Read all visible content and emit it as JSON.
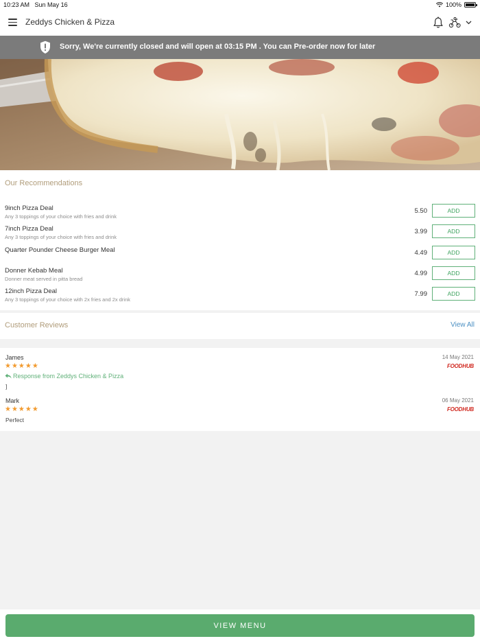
{
  "status_bar": {
    "time": "10:23 AM",
    "date": "Sun May 16",
    "battery": "100%",
    "battery_level": 1.0
  },
  "app_bar": {
    "title": "Zeddys Chicken & Pizza",
    "icons": [
      "menu-icon",
      "bell-icon",
      "delivery-icon",
      "chevron-down-icon"
    ]
  },
  "notice": {
    "message": "Sorry, We're currently closed and will open at 03:15 PM . You can Pre-order now for later",
    "icon": "shield-alert-icon"
  },
  "recommendations": {
    "title": "Our Recommendations",
    "items": [
      {
        "name": "9inch Pizza Deal",
        "description": "Any 3 toppings of your choice with fries and drink",
        "price": "5.50",
        "button": "ADD"
      },
      {
        "name": "7inch Pizza Deal",
        "description": "Any 3 toppings of your choice with fries and drink",
        "price": "3.99",
        "button": "ADD"
      },
      {
        "name": "Quarter Pounder Cheese Burger Meal",
        "description": "",
        "price": "4.49",
        "button": "ADD"
      },
      {
        "name": "Donner Kebab Meal",
        "description": "Donner meat served in pitta bread",
        "price": "4.99",
        "button": "ADD"
      },
      {
        "name": "12inch Pizza Deal",
        "description": "Any 3 toppings of your choice with 2x fries and 2x drink",
        "price": "7.99",
        "button": "ADD"
      }
    ]
  },
  "reviews": {
    "title": "Customer Reviews",
    "view_all": "View All",
    "items": [
      {
        "author": "James",
        "rating": 5,
        "stars": "★★★★★",
        "date": "14 May 2021",
        "source": "FOODHUB",
        "response": "Response from Zeddys Chicken & Pizza",
        "text": "]"
      },
      {
        "author": "Mark",
        "rating": 5,
        "stars": "★★★★★",
        "date": "06 May 2021",
        "source": "FOODHUB",
        "text": "Perfect"
      }
    ]
  },
  "footer": {
    "button": "VIEW MENU"
  },
  "colors": {
    "accent_green": "#5aab6e",
    "section_title": "#b09c7a",
    "link_blue": "#4a8fc2",
    "star": "#f29a2e",
    "notice_bg": "#7b7b7b",
    "foodhub_red": "#d0281f"
  }
}
